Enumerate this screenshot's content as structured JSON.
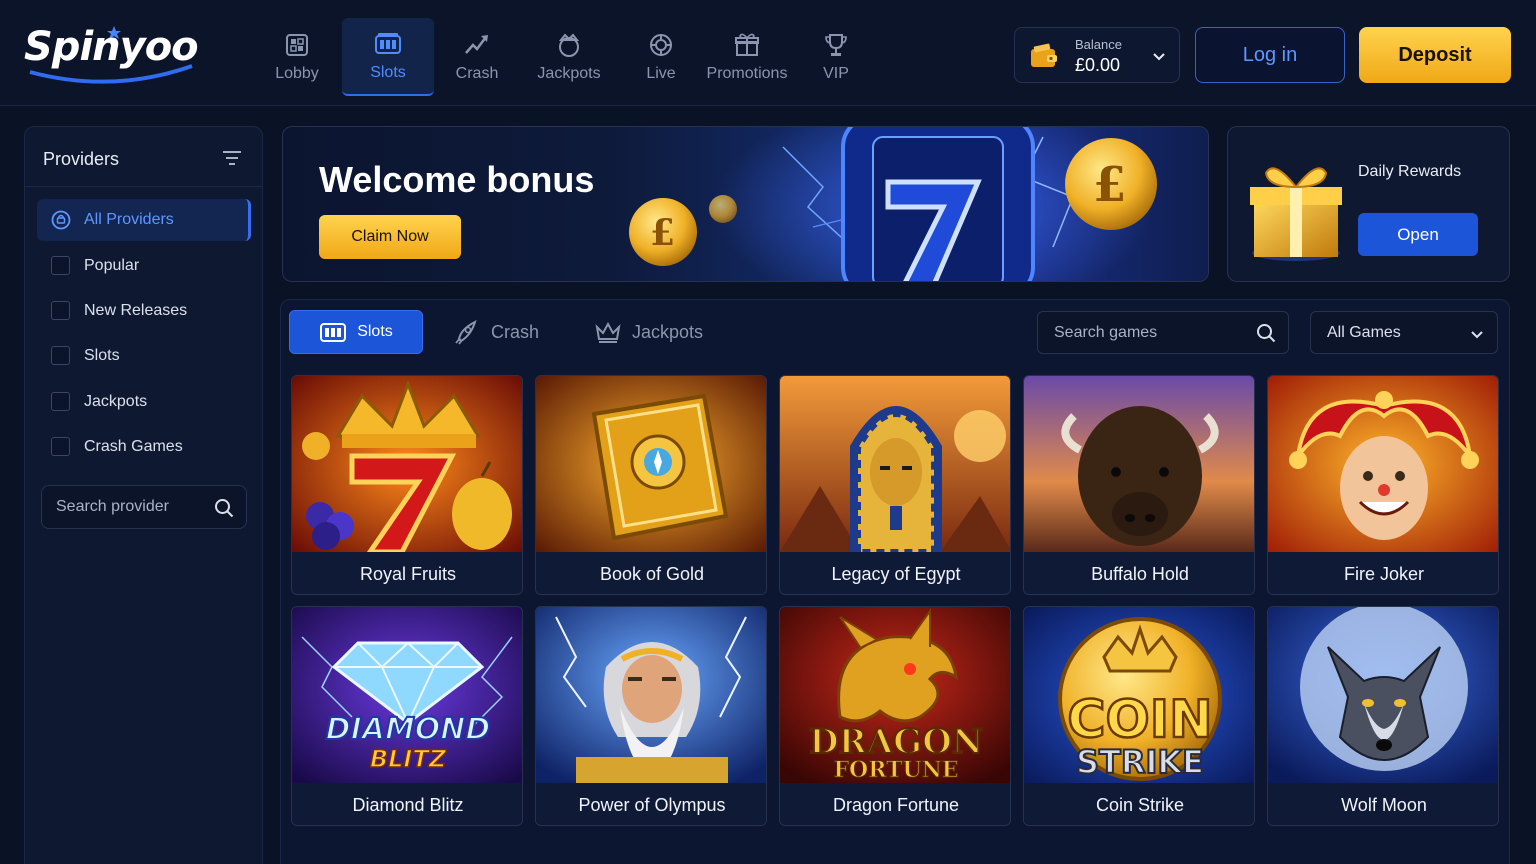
{
  "brand": {
    "name": "Spinyoo"
  },
  "nav": [
    {
      "label": "Lobby",
      "icon": "lobby-icon"
    },
    {
      "label": "Slots",
      "icon": "slot-machine-icon",
      "active": true
    },
    {
      "label": "Crash",
      "icon": "crash-chart-icon"
    },
    {
      "label": "Jackpots",
      "icon": "jackpot-icon"
    },
    {
      "label": "Live",
      "icon": "live-chip-icon"
    },
    {
      "label": "Promotions",
      "icon": "gift-icon"
    },
    {
      "label": "VIP",
      "icon": "trophy-icon"
    }
  ],
  "account": {
    "balance_label": "Balance",
    "balance_value": "£0.00",
    "login_label": "Log in",
    "deposit_label": "Deposit"
  },
  "sidebar": {
    "title": "Providers",
    "all_label": "All Providers",
    "items": [
      {
        "label": "Popular"
      },
      {
        "label": "New Releases"
      },
      {
        "label": "Slots"
      },
      {
        "label": "Jackpots"
      },
      {
        "label": "Crash Games"
      }
    ],
    "search_placeholder": "Search provider"
  },
  "banner": {
    "title": "Welcome bonus",
    "cta": "Claim Now"
  },
  "daily": {
    "label": "Daily Rewards",
    "cta": "Open"
  },
  "games_panel": {
    "tabs": [
      {
        "label": "Slots",
        "icon": "slot-machine-icon",
        "active": true
      },
      {
        "label": "Crash",
        "icon": "rocket-icon"
      },
      {
        "label": "Jackpots",
        "icon": "crown-icon"
      }
    ],
    "search_placeholder": "Search games",
    "filter_value": "All Games"
  },
  "games": [
    {
      "title": "Royal Fruits"
    },
    {
      "title": "Book of Gold"
    },
    {
      "title": "Legacy of Egypt"
    },
    {
      "title": "Buffalo Hold"
    },
    {
      "title": "Fire Joker"
    },
    {
      "title": "Diamond Blitz",
      "art_text": [
        "DIAMOND",
        "BLITZ"
      ]
    },
    {
      "title": "Power of Olympus"
    },
    {
      "title": "Dragon Fortune",
      "art_text": [
        "DRAGON",
        "FORTUNE"
      ]
    },
    {
      "title": "Coin Strike",
      "art_text": [
        "COIN",
        "STRIKE"
      ]
    },
    {
      "title": "Wolf Moon"
    }
  ],
  "colors": {
    "background": "#0a1226",
    "accent_blue": "#1d55d8",
    "link_blue": "#5f97ff",
    "gold": "#f0a816"
  }
}
